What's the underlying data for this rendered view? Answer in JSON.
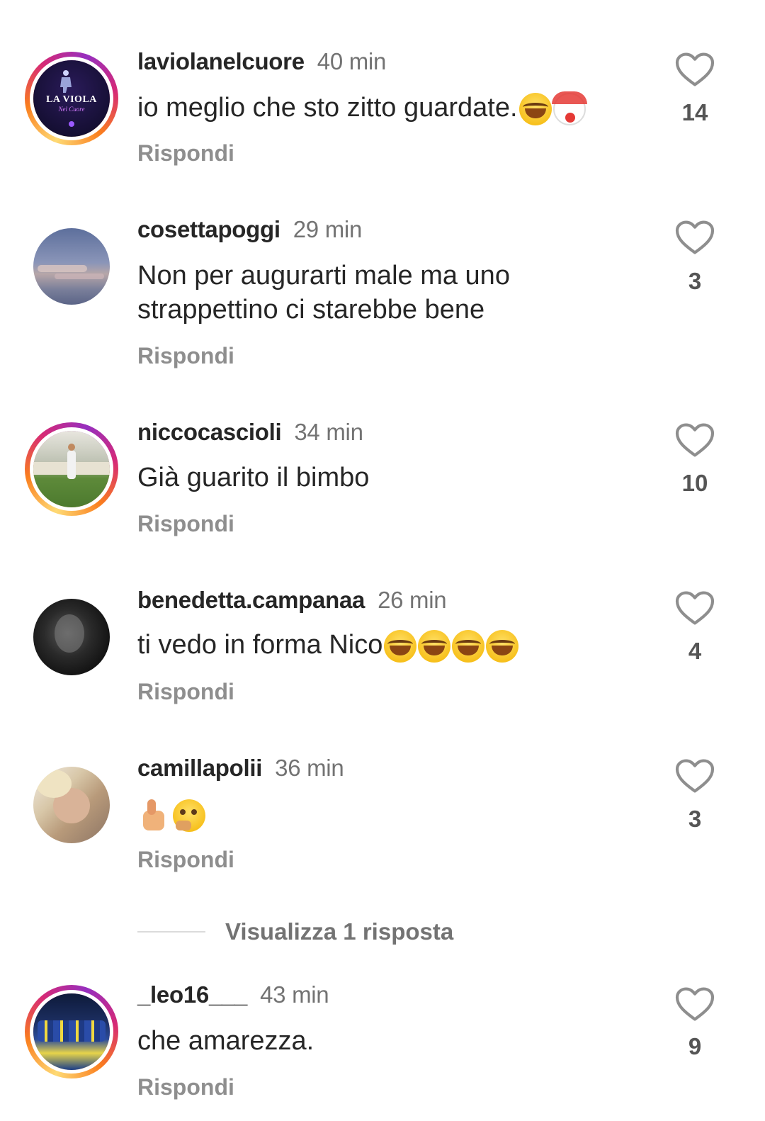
{
  "comments": [
    {
      "username": "laviolanelcuore",
      "time": "40 min",
      "text": "io meglio che sto zitto guardate.",
      "emojis": [
        "laugh",
        "clown"
      ],
      "reply": "Rispondi",
      "likes": "14",
      "avatar_text": "LA VIOLA",
      "avatar_subtext": "Nel Cuore",
      "story": true
    },
    {
      "username": "cosettapoggi",
      "time": "29 min",
      "text": "Non per augurarti male ma uno strappettino ci starebbe bene",
      "emojis": [],
      "reply": "Rispondi",
      "likes": "3",
      "story": false
    },
    {
      "username": "niccocascioli",
      "time": "34 min",
      "text": "Già guarito il bimbo",
      "emojis": [],
      "reply": "Rispondi",
      "likes": "10",
      "story": true
    },
    {
      "username": "benedetta.campanaa",
      "time": "26 min",
      "text": "ti vedo in forma Nico",
      "emojis": [
        "laugh",
        "laugh",
        "laugh",
        "laugh"
      ],
      "reply": "Rispondi",
      "likes": "4",
      "story": false
    },
    {
      "username": "camillapolii",
      "time": "36 min",
      "text": "",
      "emojis": [
        "thumb",
        "think"
      ],
      "reply": "Rispondi",
      "likes": "3",
      "story": false
    },
    {
      "username": "_leo16___",
      "time": "43 min",
      "text": "che amarezza.",
      "emojis": [],
      "reply": "Rispondi",
      "likes": "9",
      "story": true
    }
  ],
  "view_replies": "Visualizza 1 risposta",
  "icons": {
    "like": "heart-outline-icon"
  },
  "colors": {
    "text": "#262626",
    "secondary": "#737373",
    "story_ring": [
      "#feda75",
      "#fa7e1e",
      "#d62976",
      "#962fbf"
    ]
  }
}
